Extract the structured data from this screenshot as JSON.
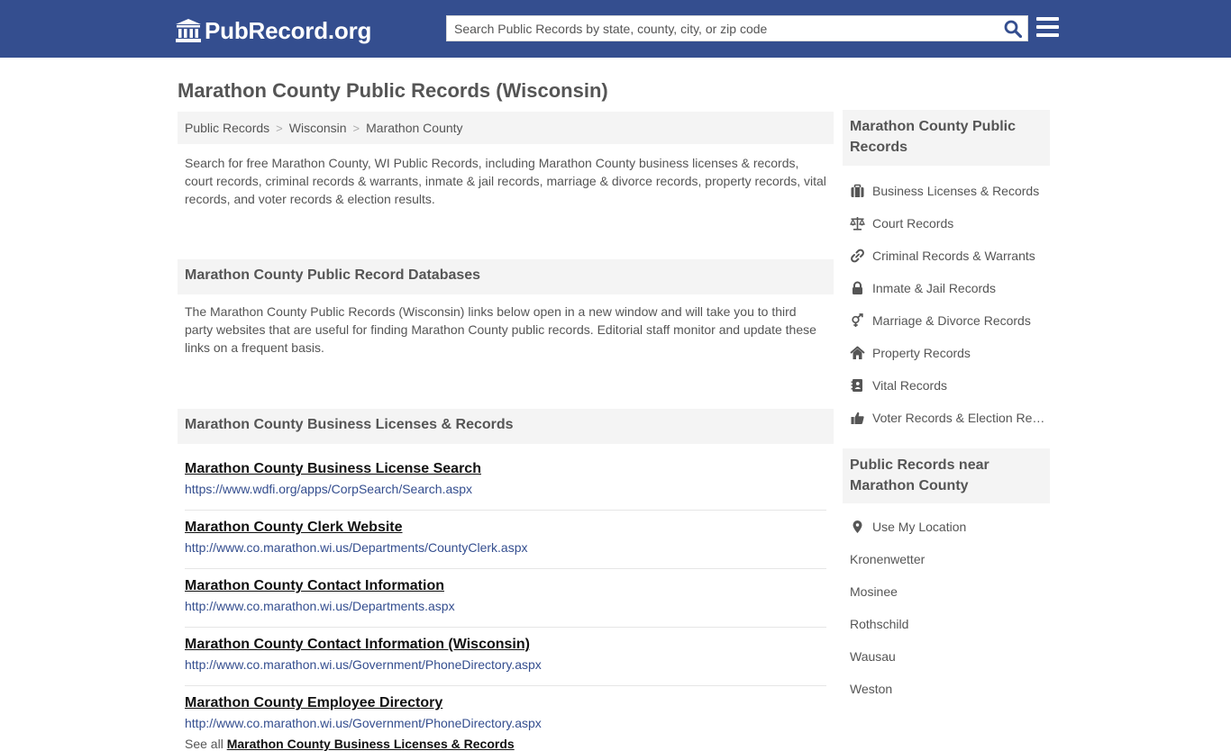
{
  "header": {
    "logo_text": "PubRecord.org",
    "search_placeholder": "Search Public Records by state, county, city, or zip code"
  },
  "page_title": "Marathon County Public Records (Wisconsin)",
  "breadcrumb": [
    "Public Records",
    "Wisconsin",
    "Marathon County"
  ],
  "breadcrumb_sep": ">",
  "intro": "Search for free Marathon County, WI Public Records, including Marathon County business licenses & records, court records, criminal records & warrants, inmate & jail records, marriage & divorce records, property records, vital records, and voter records & election results.",
  "databases": {
    "heading": "Marathon County Public Record Databases",
    "description": "The Marathon County Public Records (Wisconsin) links below open in a new window and will take you to third party websites that are useful for finding Marathon County public records. Editorial staff monitor and update these links on a frequent basis."
  },
  "business": {
    "heading": "Marathon County Business Licenses & Records",
    "links": [
      {
        "title": "Marathon County Business License Search",
        "url": "https://www.wdfi.org/apps/CorpSearch/Search.aspx"
      },
      {
        "title": "Marathon County Clerk Website",
        "url": "http://www.co.marathon.wi.us/Departments/CountyClerk.aspx"
      },
      {
        "title": "Marathon County Contact Information",
        "url": "http://www.co.marathon.wi.us/Departments.aspx"
      },
      {
        "title": "Marathon County Contact Information (Wisconsin)",
        "url": "http://www.co.marathon.wi.us/Government/PhoneDirectory.aspx"
      },
      {
        "title": "Marathon County Employee Directory",
        "url": "http://www.co.marathon.wi.us/Government/PhoneDirectory.aspx"
      }
    ],
    "see_all_prefix": "See all",
    "see_all_link": "Marathon County Business Licenses & Records"
  },
  "sidebar": {
    "records_heading": "Marathon County Public Records",
    "records": [
      {
        "label": "Business Licenses & Records",
        "icon": "briefcase-icon"
      },
      {
        "label": "Court Records",
        "icon": "scales-icon"
      },
      {
        "label": "Criminal Records & Warrants",
        "icon": "link-icon"
      },
      {
        "label": "Inmate & Jail Records",
        "icon": "lock-icon"
      },
      {
        "label": "Marriage & Divorce Records",
        "icon": "gender-icon"
      },
      {
        "label": "Property Records",
        "icon": "home-icon"
      },
      {
        "label": "Vital Records",
        "icon": "address-book-icon"
      },
      {
        "label": "Voter Records & Election Results",
        "icon": "thumbs-up-icon"
      }
    ],
    "near_heading": "Public Records near Marathon County",
    "use_location": "Use My Location",
    "places": [
      "Kronenwetter",
      "Mosinee",
      "Rothschild",
      "Wausau",
      "Weston"
    ]
  },
  "colors": {
    "header_bg": "#344e8f",
    "link_url": "#344e8f",
    "panel_bg": "#f4f4f4"
  }
}
